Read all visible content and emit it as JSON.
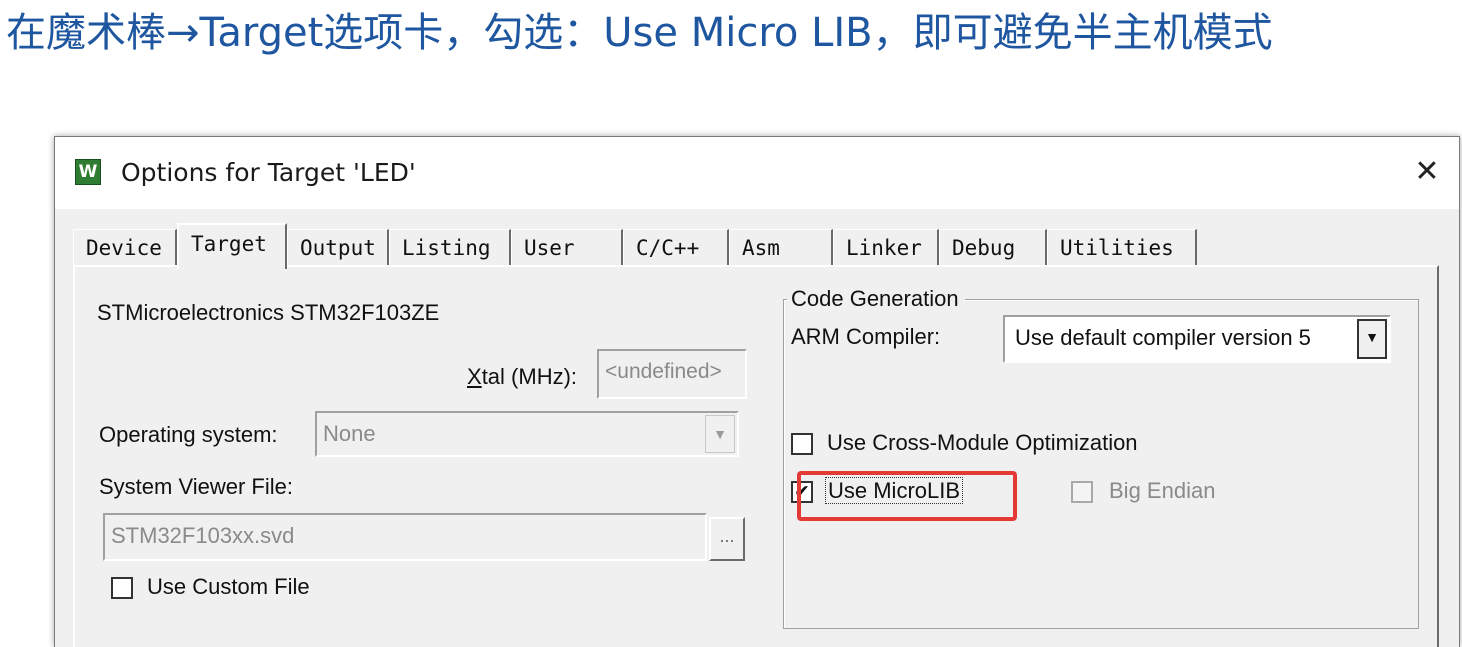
{
  "slide": {
    "title": "在魔术棒→Target选项卡，勾选：Use Micro LIB，即可避免半主机模式"
  },
  "dialog": {
    "title": "Options for Target 'LED'",
    "close_symbol": "✕",
    "tabs": [
      {
        "label": "Device",
        "active": false
      },
      {
        "label": "Target",
        "active": true
      },
      {
        "label": "Output",
        "active": false
      },
      {
        "label": "Listing",
        "active": false
      },
      {
        "label": "User",
        "active": false
      },
      {
        "label": "C/C++",
        "active": false
      },
      {
        "label": "Asm",
        "active": false
      },
      {
        "label": "Linker",
        "active": false
      },
      {
        "label": "Debug",
        "active": false
      },
      {
        "label": "Utilities",
        "active": false
      }
    ]
  },
  "target": {
    "device_name": "STMicroelectronics STM32F103ZE",
    "xtal": {
      "label_first": "X",
      "label_rest": "tal (MHz):",
      "value": "<undefined>"
    },
    "os": {
      "label": "Operating system:",
      "value": "None"
    },
    "svd": {
      "label": "System Viewer File:",
      "value": "STM32F103xx.svd",
      "browse": "..."
    },
    "custom_file": {
      "label": "Use Custom File",
      "checked": false
    }
  },
  "code_gen": {
    "legend": "Code Generation",
    "compiler": {
      "label": "ARM Compiler:",
      "value": "Use default compiler version 5"
    },
    "cross_module": {
      "label": "Use Cross-Module Optimization",
      "checked": false
    },
    "microlib": {
      "label": "Use MicroLIB",
      "checked": true,
      "check_glyph": "✔"
    },
    "big_endian": {
      "label_pre": "Bi",
      "label_u": "g",
      "label_post": " Endian",
      "checked": false,
      "enabled": false
    }
  },
  "colors": {
    "slide_title": "#1e56a0",
    "highlight": "#e53935",
    "dialog_bg": "#f0f0f0"
  }
}
